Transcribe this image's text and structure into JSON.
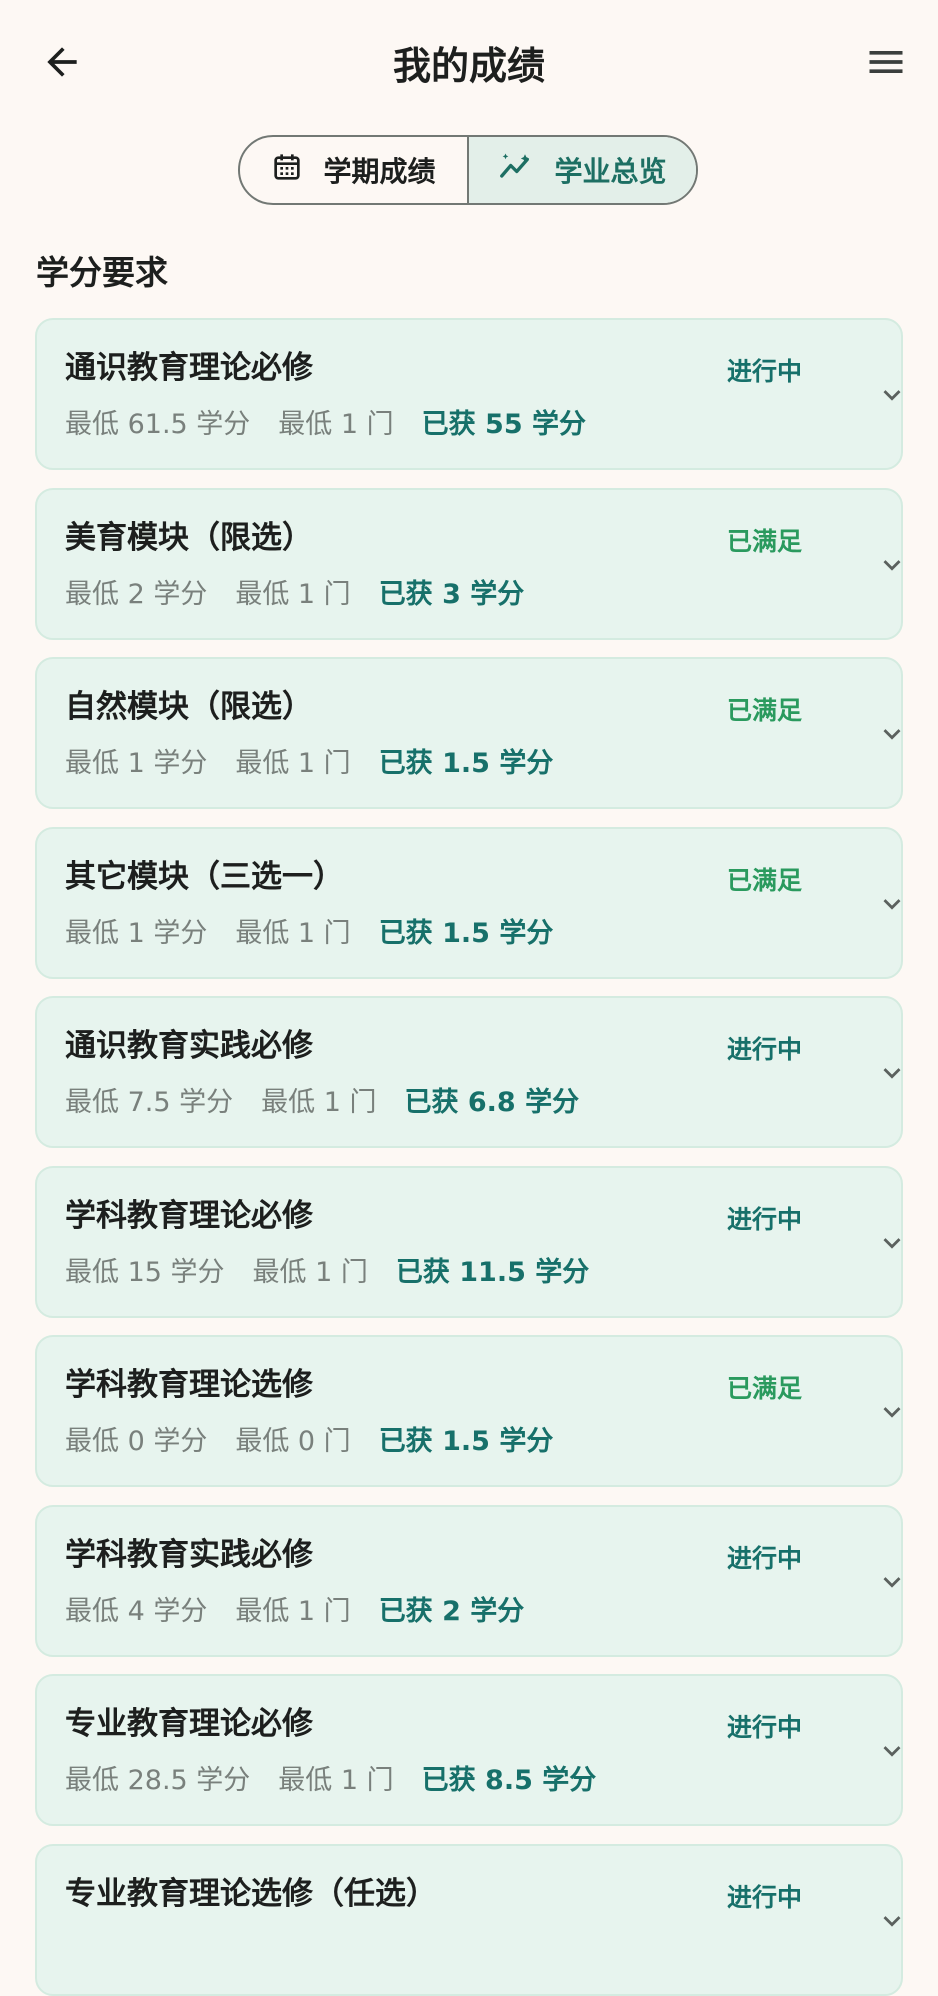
{
  "header": {
    "title": "我的成绩",
    "back_icon": "arrow-left-icon",
    "menu_icon": "hamburger-menu-icon"
  },
  "tabs": [
    {
      "label": "学期成绩",
      "icon": "calendar-icon",
      "selected": false
    },
    {
      "label": "学业总览",
      "icon": "trend-chart-icon",
      "selected": true
    }
  ],
  "section": {
    "title": "学分要求"
  },
  "colors": {
    "background": "#fdf8f4",
    "card": "#e7f4ee",
    "accent": "#17706a",
    "status_done": "#2a9a5e",
    "muted": "#79807c"
  },
  "requirements": [
    {
      "title": "通识教育理论必修",
      "status": "进行中",
      "status_type": "progress",
      "min_credits": "最低 61.5 学分",
      "min_courses": "最低 1 门",
      "earned": "已获 55 学分"
    },
    {
      "title": "美育模块（限选）",
      "status": "已满足",
      "status_type": "done",
      "min_credits": "最低 2 学分",
      "min_courses": "最低 1 门",
      "earned": "已获 3 学分"
    },
    {
      "title": "自然模块（限选）",
      "status": "已满足",
      "status_type": "done",
      "min_credits": "最低 1 学分",
      "min_courses": "最低 1 门",
      "earned": "已获 1.5 学分"
    },
    {
      "title": "其它模块（三选一）",
      "status": "已满足",
      "status_type": "done",
      "min_credits": "最低 1 学分",
      "min_courses": "最低 1 门",
      "earned": "已获 1.5 学分"
    },
    {
      "title": "通识教育实践必修",
      "status": "进行中",
      "status_type": "progress",
      "min_credits": "最低 7.5 学分",
      "min_courses": "最低 1 门",
      "earned": "已获 6.8 学分"
    },
    {
      "title": "学科教育理论必修",
      "status": "进行中",
      "status_type": "progress",
      "min_credits": "最低 15 学分",
      "min_courses": "最低 1 门",
      "earned": "已获 11.5 学分"
    },
    {
      "title": "学科教育理论选修",
      "status": "已满足",
      "status_type": "done",
      "min_credits": "最低 0 学分",
      "min_courses": "最低 0 门",
      "earned": "已获 1.5 学分"
    },
    {
      "title": "学科教育实践必修",
      "status": "进行中",
      "status_type": "progress",
      "min_credits": "最低 4 学分",
      "min_courses": "最低 1 门",
      "earned": "已获 2 学分"
    },
    {
      "title": "专业教育理论必修",
      "status": "进行中",
      "status_type": "progress",
      "min_credits": "最低 28.5 学分",
      "min_courses": "最低 1 门",
      "earned": "已获 8.5 学分"
    },
    {
      "title": "专业教育理论选修（任选）",
      "status": "进行中",
      "status_type": "progress",
      "min_credits": "",
      "min_courses": "",
      "earned": ""
    }
  ]
}
